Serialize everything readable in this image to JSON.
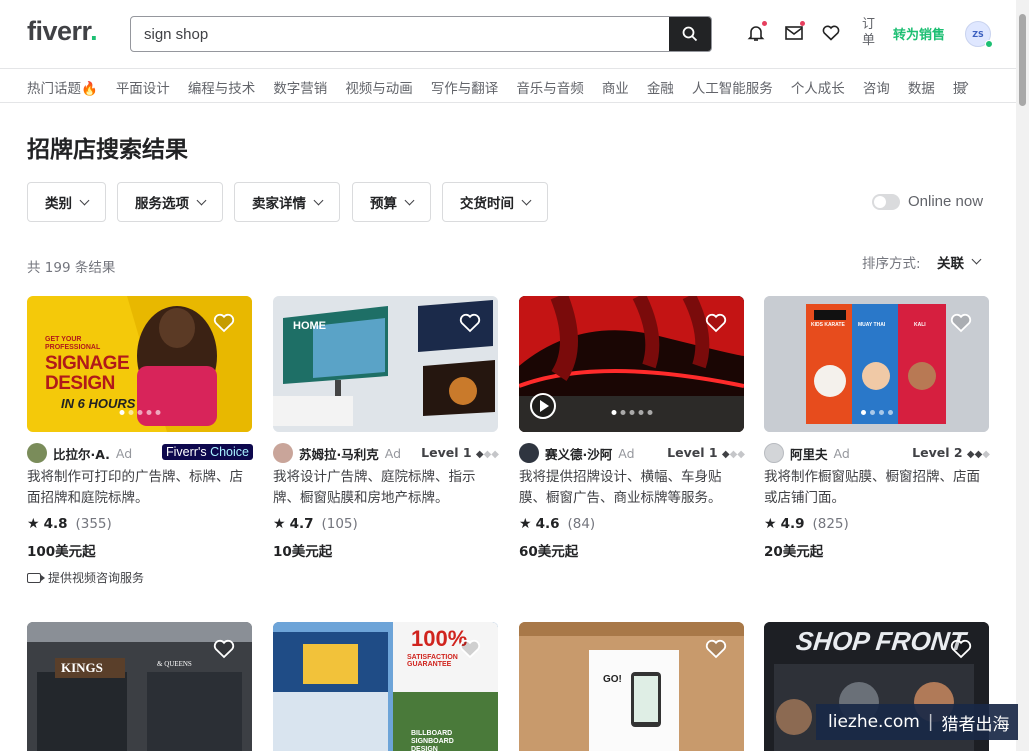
{
  "header": {
    "logo": "fiverr",
    "logo_dot": ".",
    "search_value": "sign shop",
    "orders_label": "订单",
    "become_seller_label": "转为销售",
    "avatar_text": "ZS",
    "brand_color": "#1dbf73"
  },
  "categories": [
    "热门话题🔥",
    "平面设计",
    "编程与技术",
    "数字营销",
    "视频与动画",
    "写作与翻译",
    "音乐与音频",
    "商业",
    "金融",
    "人工智能服务",
    "个人成长",
    "咨询",
    "数据",
    "摄"
  ],
  "categories_more": "›",
  "page": {
    "title_bold": "招牌店",
    "title_rest": "搜索结果",
    "filters": [
      "类别",
      "服务选项",
      "卖家详情",
      "预算",
      "交货时间"
    ],
    "online_now": "Online now",
    "result_count": "共 199 条结果",
    "sort_label": "排序方式:",
    "sort_value": "关联"
  },
  "gigs": [
    {
      "seller": "比拉尔·A.",
      "ad": "Ad",
      "badge": "Fiverr's Choice",
      "badge_a": "Fiverr's ",
      "badge_b": "Choice",
      "description": "我将制作可打印的广告牌、标牌、店面招牌和庭院标牌。",
      "rating": "4.8",
      "reviews": "(355)",
      "price": "100美元起",
      "video_consult": "提供视频咨询服务",
      "thumb_text_1": "GET YOUR PROFESSIONAL",
      "thumb_text_2": "SIGNAGE DESIGN",
      "thumb_text_3": "IN 6 HOURS"
    },
    {
      "seller": "苏姆拉·马利克",
      "ad": "Ad",
      "level": "Level 1",
      "description": "我将设计广告牌、庭院标牌、指示牌、橱窗贴膜和房地产标牌。",
      "rating": "4.7",
      "reviews": "(105)",
      "price": "10美元起",
      "thumb_text_1": "HOME"
    },
    {
      "seller": "赛义德·沙阿",
      "ad": "Ad",
      "level": "Level 1",
      "description": "我将提供招牌设计、横幅、车身贴膜、橱窗广告、商业标牌等服务。",
      "rating": "4.6",
      "reviews": "(84)",
      "price": "60美元起"
    },
    {
      "seller": "阿里夫",
      "ad": "Ad",
      "level": "Level 2",
      "description": "我将制作橱窗贴膜、橱窗招牌、店面或店铺门面。",
      "rating": "4.9",
      "reviews": "(825)",
      "price": "20美元起",
      "thumb_text_1": "KIDS KARATE",
      "thumb_text_2": "MUAY THAI",
      "thumb_text_3": "KALI"
    }
  ],
  "gigs_row2": [
    {
      "thumb_text_1": "KINGS",
      "thumb_text_2": "& QUEENS"
    },
    {
      "thumb_text_1": "100%",
      "thumb_text_2": "SATISFACTION GUARANTEE",
      "thumb_text_3": "BILLBOARD SIGNBOARD DESIGN"
    },
    {
      "thumb_text_1": "GO!"
    },
    {
      "thumb_text_1": "SHOP FRONT"
    }
  ],
  "watermark": {
    "left": "liezhe.com",
    "sep": "|",
    "right": "猎者出海"
  }
}
